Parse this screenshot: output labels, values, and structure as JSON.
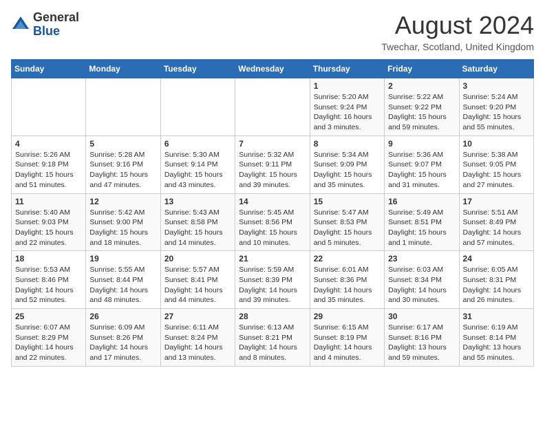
{
  "header": {
    "logo_general": "General",
    "logo_blue": "Blue",
    "month_title": "August 2024",
    "location": "Twechar, Scotland, United Kingdom"
  },
  "calendar": {
    "headers": [
      "Sunday",
      "Monday",
      "Tuesday",
      "Wednesday",
      "Thursday",
      "Friday",
      "Saturday"
    ],
    "weeks": [
      [
        {
          "day": "",
          "info": ""
        },
        {
          "day": "",
          "info": ""
        },
        {
          "day": "",
          "info": ""
        },
        {
          "day": "",
          "info": ""
        },
        {
          "day": "1",
          "info": "Sunrise: 5:20 AM\nSunset: 9:24 PM\nDaylight: 16 hours\nand 3 minutes."
        },
        {
          "day": "2",
          "info": "Sunrise: 5:22 AM\nSunset: 9:22 PM\nDaylight: 15 hours\nand 59 minutes."
        },
        {
          "day": "3",
          "info": "Sunrise: 5:24 AM\nSunset: 9:20 PM\nDaylight: 15 hours\nand 55 minutes."
        }
      ],
      [
        {
          "day": "4",
          "info": "Sunrise: 5:26 AM\nSunset: 9:18 PM\nDaylight: 15 hours\nand 51 minutes."
        },
        {
          "day": "5",
          "info": "Sunrise: 5:28 AM\nSunset: 9:16 PM\nDaylight: 15 hours\nand 47 minutes."
        },
        {
          "day": "6",
          "info": "Sunrise: 5:30 AM\nSunset: 9:14 PM\nDaylight: 15 hours\nand 43 minutes."
        },
        {
          "day": "7",
          "info": "Sunrise: 5:32 AM\nSunset: 9:11 PM\nDaylight: 15 hours\nand 39 minutes."
        },
        {
          "day": "8",
          "info": "Sunrise: 5:34 AM\nSunset: 9:09 PM\nDaylight: 15 hours\nand 35 minutes."
        },
        {
          "day": "9",
          "info": "Sunrise: 5:36 AM\nSunset: 9:07 PM\nDaylight: 15 hours\nand 31 minutes."
        },
        {
          "day": "10",
          "info": "Sunrise: 5:38 AM\nSunset: 9:05 PM\nDaylight: 15 hours\nand 27 minutes."
        }
      ],
      [
        {
          "day": "11",
          "info": "Sunrise: 5:40 AM\nSunset: 9:03 PM\nDaylight: 15 hours\nand 22 minutes."
        },
        {
          "day": "12",
          "info": "Sunrise: 5:42 AM\nSunset: 9:00 PM\nDaylight: 15 hours\nand 18 minutes."
        },
        {
          "day": "13",
          "info": "Sunrise: 5:43 AM\nSunset: 8:58 PM\nDaylight: 15 hours\nand 14 minutes."
        },
        {
          "day": "14",
          "info": "Sunrise: 5:45 AM\nSunset: 8:56 PM\nDaylight: 15 hours\nand 10 minutes."
        },
        {
          "day": "15",
          "info": "Sunrise: 5:47 AM\nSunset: 8:53 PM\nDaylight: 15 hours\nand 5 minutes."
        },
        {
          "day": "16",
          "info": "Sunrise: 5:49 AM\nSunset: 8:51 PM\nDaylight: 15 hours\nand 1 minute."
        },
        {
          "day": "17",
          "info": "Sunrise: 5:51 AM\nSunset: 8:49 PM\nDaylight: 14 hours\nand 57 minutes."
        }
      ],
      [
        {
          "day": "18",
          "info": "Sunrise: 5:53 AM\nSunset: 8:46 PM\nDaylight: 14 hours\nand 52 minutes."
        },
        {
          "day": "19",
          "info": "Sunrise: 5:55 AM\nSunset: 8:44 PM\nDaylight: 14 hours\nand 48 minutes."
        },
        {
          "day": "20",
          "info": "Sunrise: 5:57 AM\nSunset: 8:41 PM\nDaylight: 14 hours\nand 44 minutes."
        },
        {
          "day": "21",
          "info": "Sunrise: 5:59 AM\nSunset: 8:39 PM\nDaylight: 14 hours\nand 39 minutes."
        },
        {
          "day": "22",
          "info": "Sunrise: 6:01 AM\nSunset: 8:36 PM\nDaylight: 14 hours\nand 35 minutes."
        },
        {
          "day": "23",
          "info": "Sunrise: 6:03 AM\nSunset: 8:34 PM\nDaylight: 14 hours\nand 30 minutes."
        },
        {
          "day": "24",
          "info": "Sunrise: 6:05 AM\nSunset: 8:31 PM\nDaylight: 14 hours\nand 26 minutes."
        }
      ],
      [
        {
          "day": "25",
          "info": "Sunrise: 6:07 AM\nSunset: 8:29 PM\nDaylight: 14 hours\nand 22 minutes."
        },
        {
          "day": "26",
          "info": "Sunrise: 6:09 AM\nSunset: 8:26 PM\nDaylight: 14 hours\nand 17 minutes."
        },
        {
          "day": "27",
          "info": "Sunrise: 6:11 AM\nSunset: 8:24 PM\nDaylight: 14 hours\nand 13 minutes."
        },
        {
          "day": "28",
          "info": "Sunrise: 6:13 AM\nSunset: 8:21 PM\nDaylight: 14 hours\nand 8 minutes."
        },
        {
          "day": "29",
          "info": "Sunrise: 6:15 AM\nSunset: 8:19 PM\nDaylight: 14 hours\nand 4 minutes."
        },
        {
          "day": "30",
          "info": "Sunrise: 6:17 AM\nSunset: 8:16 PM\nDaylight: 13 hours\nand 59 minutes."
        },
        {
          "day": "31",
          "info": "Sunrise: 6:19 AM\nSunset: 8:14 PM\nDaylight: 13 hours\nand 55 minutes."
        }
      ]
    ]
  }
}
